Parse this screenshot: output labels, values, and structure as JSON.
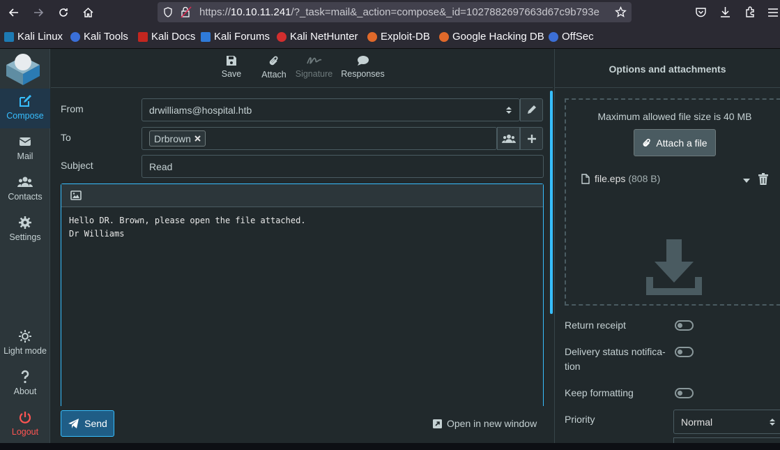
{
  "browser": {
    "url_prefix": "https://",
    "url_host": "10.10.11.241",
    "url_rest": "/?_task=mail&_action=compose&_id=1027882697663d67c9b793e",
    "bookmarks": [
      "Kali Linux",
      "Kali Tools",
      "Kali Docs",
      "Kali Forums",
      "Kali NetHunter",
      "Exploit-DB",
      "Google Hacking DB",
      "OffSec"
    ]
  },
  "sidebar": {
    "compose": "Compose",
    "mail": "Mail",
    "contacts": "Contacts",
    "settings": "Settings",
    "light_mode": "Light mode",
    "about": "About",
    "logout": "Logout"
  },
  "toolbar": {
    "save": "Save",
    "attach": "Attach",
    "signature": "Signature",
    "responses": "Responses"
  },
  "form": {
    "from_label": "From",
    "from_value": "drwilliams@hospital.htb",
    "to_label": "To",
    "to_recipient": "Drbrown",
    "subject_label": "Subject",
    "subject_value": "Read",
    "body": "Hello DR. Brown, please open the file attached.\nDr Williams"
  },
  "bottom": {
    "send": "Send",
    "open_new_window": "Open in new window"
  },
  "options": {
    "title": "Options and attachments",
    "max_size": "Maximum allowed file size is 40 MB",
    "attach_button": "Attach a file",
    "file_name": "file.eps",
    "file_size": "(808 B)",
    "return_receipt": "Return receipt",
    "delivery_status": "Delivery status notifica-tion",
    "keep_formatting": "Keep formatting",
    "priority_label": "Priority",
    "priority_value": "Normal"
  },
  "colors": {
    "accent": "#37beff",
    "logout": "#ff5552",
    "panel": "#21292c"
  }
}
